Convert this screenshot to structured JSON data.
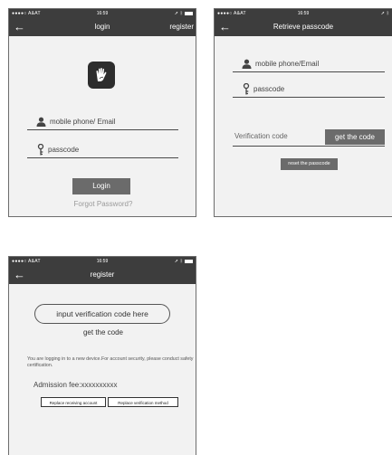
{
  "status": {
    "carrier": "●●●●○ A&AT",
    "wifi": "wifi-icon",
    "time": "16:59",
    "location": "location-arrow-icon",
    "bluetooth": "bluetooth-icon",
    "battery": "battery-icon"
  },
  "login": {
    "title": "login",
    "register_label": "register",
    "phone_placeholder": "mobile phone/ Email",
    "passcode_placeholder": "passcode",
    "login_button": "Login",
    "forgot_link": "Forgot Password?"
  },
  "retrieve": {
    "title": "Retrieve passcode",
    "phone_placeholder": "mobile phone/Email",
    "passcode_placeholder": "passcode",
    "verification_label": "Verification code",
    "get_code_button": "get the code",
    "reset_button": "reset the passcode"
  },
  "register": {
    "title": "register",
    "input_placeholder": "input verification code here",
    "get_code_link": "get the code",
    "notice": "You are logging in to a new device.For account security, please conduct safety certification.",
    "fee_label": "Admission fee:",
    "fee_value": "xxxxxxxxxx",
    "replace_account_button": "Replace receiving account",
    "replace_method_button": "Replace verification method"
  },
  "colors": {
    "bar": "#3d3d3d",
    "background": "#f2f2f2",
    "button": "#6b6b6b",
    "link": "#9a9a9a"
  }
}
